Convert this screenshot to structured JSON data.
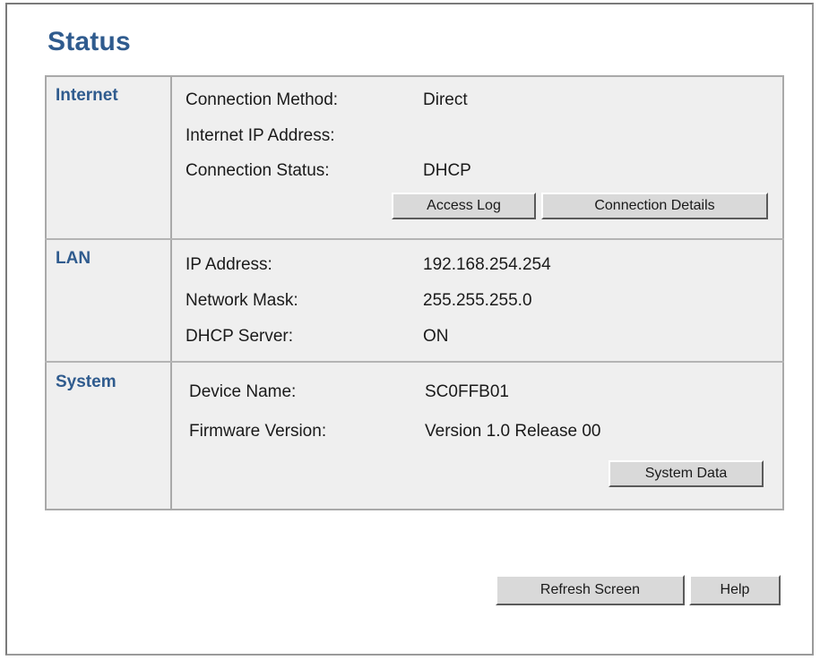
{
  "page": {
    "title": "Status"
  },
  "internet": {
    "label": "Internet",
    "rows": [
      {
        "label": "Connection Method:",
        "value": "Direct"
      },
      {
        "label": "Internet IP Address:",
        "value": ""
      },
      {
        "label": "Connection Status:",
        "value": "DHCP"
      }
    ],
    "buttons": {
      "access_log": "Access Log",
      "connection_details": "Connection Details"
    }
  },
  "lan": {
    "label": "LAN",
    "rows": [
      {
        "label": "IP Address:",
        "value": "192.168.254.254"
      },
      {
        "label": "Network Mask:",
        "value": "255.255.255.0"
      },
      {
        "label": "DHCP Server:",
        "value": "ON"
      }
    ]
  },
  "system": {
    "label": "System",
    "rows": [
      {
        "label": "Device Name:",
        "value": "SC0FFB01"
      },
      {
        "label": "Firmware Version:",
        "value": "Version 1.0 Release 00"
      }
    ],
    "buttons": {
      "system_data": "System Data"
    }
  },
  "footer": {
    "refresh": "Refresh Screen",
    "help": "Help"
  }
}
